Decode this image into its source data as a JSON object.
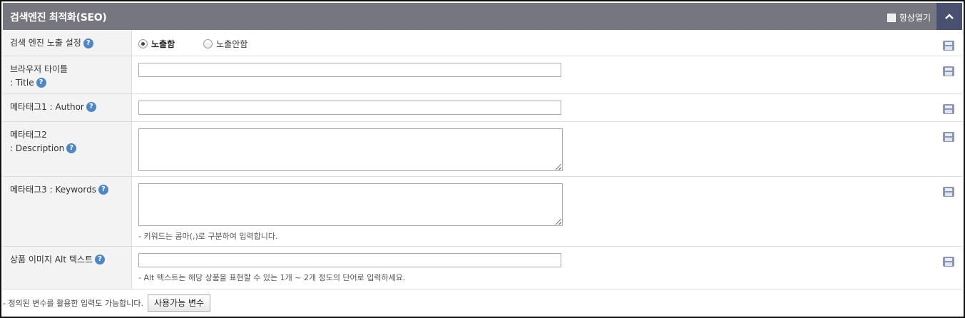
{
  "header": {
    "title": "검색엔진 최적화(SEO)",
    "always_open_label": "항상열기"
  },
  "rows": {
    "seo_exposure": {
      "label": "검색 엔진 노출 설정",
      "options": [
        "노출함",
        "노출안함"
      ],
      "selected": "노출함"
    },
    "browser_title": {
      "label_line1": "브라우저 타이틀",
      "label_line2": ": Title",
      "value": ""
    },
    "meta_author": {
      "label": "메타태그1 : Author",
      "value": ""
    },
    "meta_description": {
      "label_line1": "메타태그2",
      "label_line2": ": Description",
      "value": ""
    },
    "meta_keywords": {
      "label": "메타태그3 : Keywords",
      "value": "",
      "hint": "- 키워드는 콤마(,)로 구분하여 입력합니다."
    },
    "image_alt": {
      "label": "상품 이미지 Alt 텍스트",
      "value": "",
      "hint": "- Alt 텍스트는 해당 상품을 표현할 수 있는 1개 ~  2개 정도의 단어로 입력하세요."
    }
  },
  "footer": {
    "note": "- 정의된 변수를 활용한 입력도 가능합니다.",
    "variables_button": "사용가능 변수"
  },
  "help_glyph": "?",
  "colors": {
    "header_bg": "#76767e",
    "collapse_bg": "#4a5070",
    "help_icon": "#4f86c6"
  }
}
